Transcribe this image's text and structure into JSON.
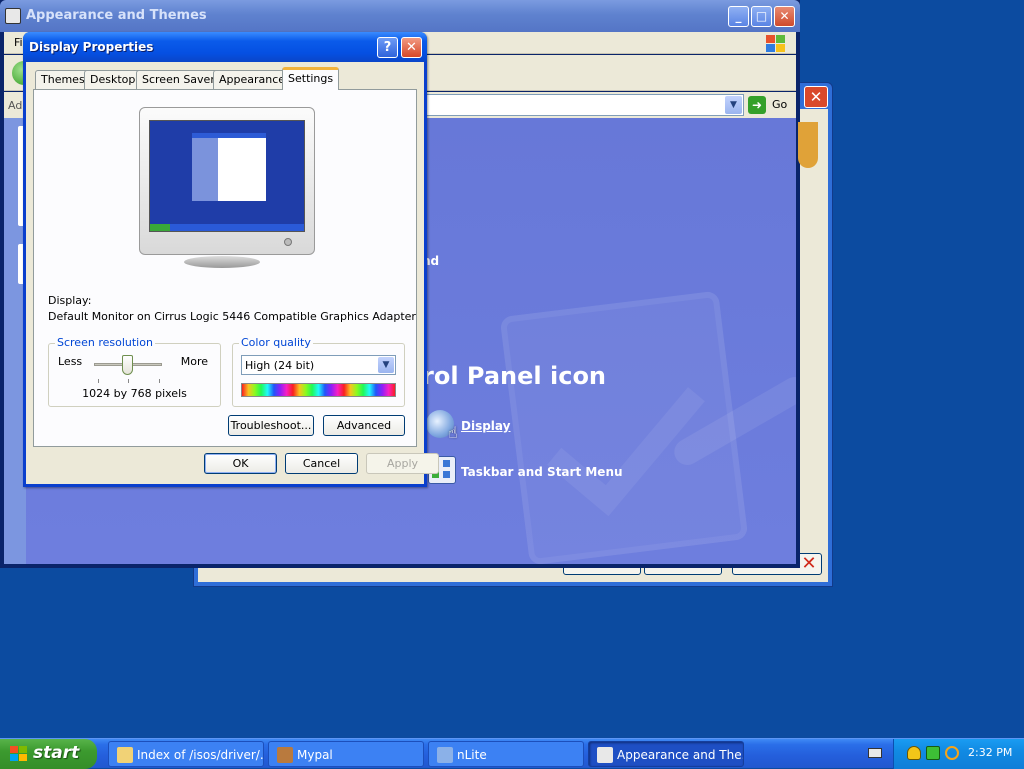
{
  "background_window": {
    "title": "Appearance and Themes",
    "menu_partial": "Fi",
    "address_partial": "Ad",
    "go_label": "Go",
    "content": {
      "fragment_small": "e",
      "fragment_1": "nd",
      "heading": "rol Panel icon",
      "links": [
        {
          "label": "Display",
          "icon": "display-icon"
        },
        {
          "label": "Taskbar and Start Menu",
          "icon": "taskbar-icon"
        }
      ]
    }
  },
  "dialog": {
    "title": "Display Properties",
    "tabs": [
      "Themes",
      "Desktop",
      "Screen Saver",
      "Appearance",
      "Settings"
    ],
    "active_tab": "Settings",
    "display_label": "Display:",
    "display_value": "Default Monitor on Cirrus Logic 5446 Compatible Graphics Adapter",
    "screen_resolution": {
      "legend": "Screen resolution",
      "less": "Less",
      "more": "More",
      "value": "1024 by 768 pixels",
      "slider_position": 0.5
    },
    "color_quality": {
      "legend": "Color quality",
      "selected": "High (24 bit)"
    },
    "buttons": {
      "troubleshoot": "Troubleshoot...",
      "advanced": "Advanced",
      "ok": "OK",
      "cancel": "Cancel",
      "apply": "Apply"
    }
  },
  "taskbar": {
    "start_label": "start",
    "tasks": [
      {
        "label": "Index of /isos/driver/...",
        "icon": "folder-icon",
        "active": false
      },
      {
        "label": "Mypal",
        "icon": "browser-icon",
        "active": false
      },
      {
        "label": "nLite",
        "icon": "nlite-icon",
        "active": false
      },
      {
        "label": "Appearance and The...",
        "icon": "control-panel-icon",
        "active": true
      }
    ],
    "clock": "2:32 PM"
  },
  "colors": {
    "desktop": "#0c4ba0",
    "dialog_title": "#0550e2",
    "control_panel_content": "#6e7ede",
    "start_button": "#3c9a2f",
    "taskbar": "#245edb"
  }
}
